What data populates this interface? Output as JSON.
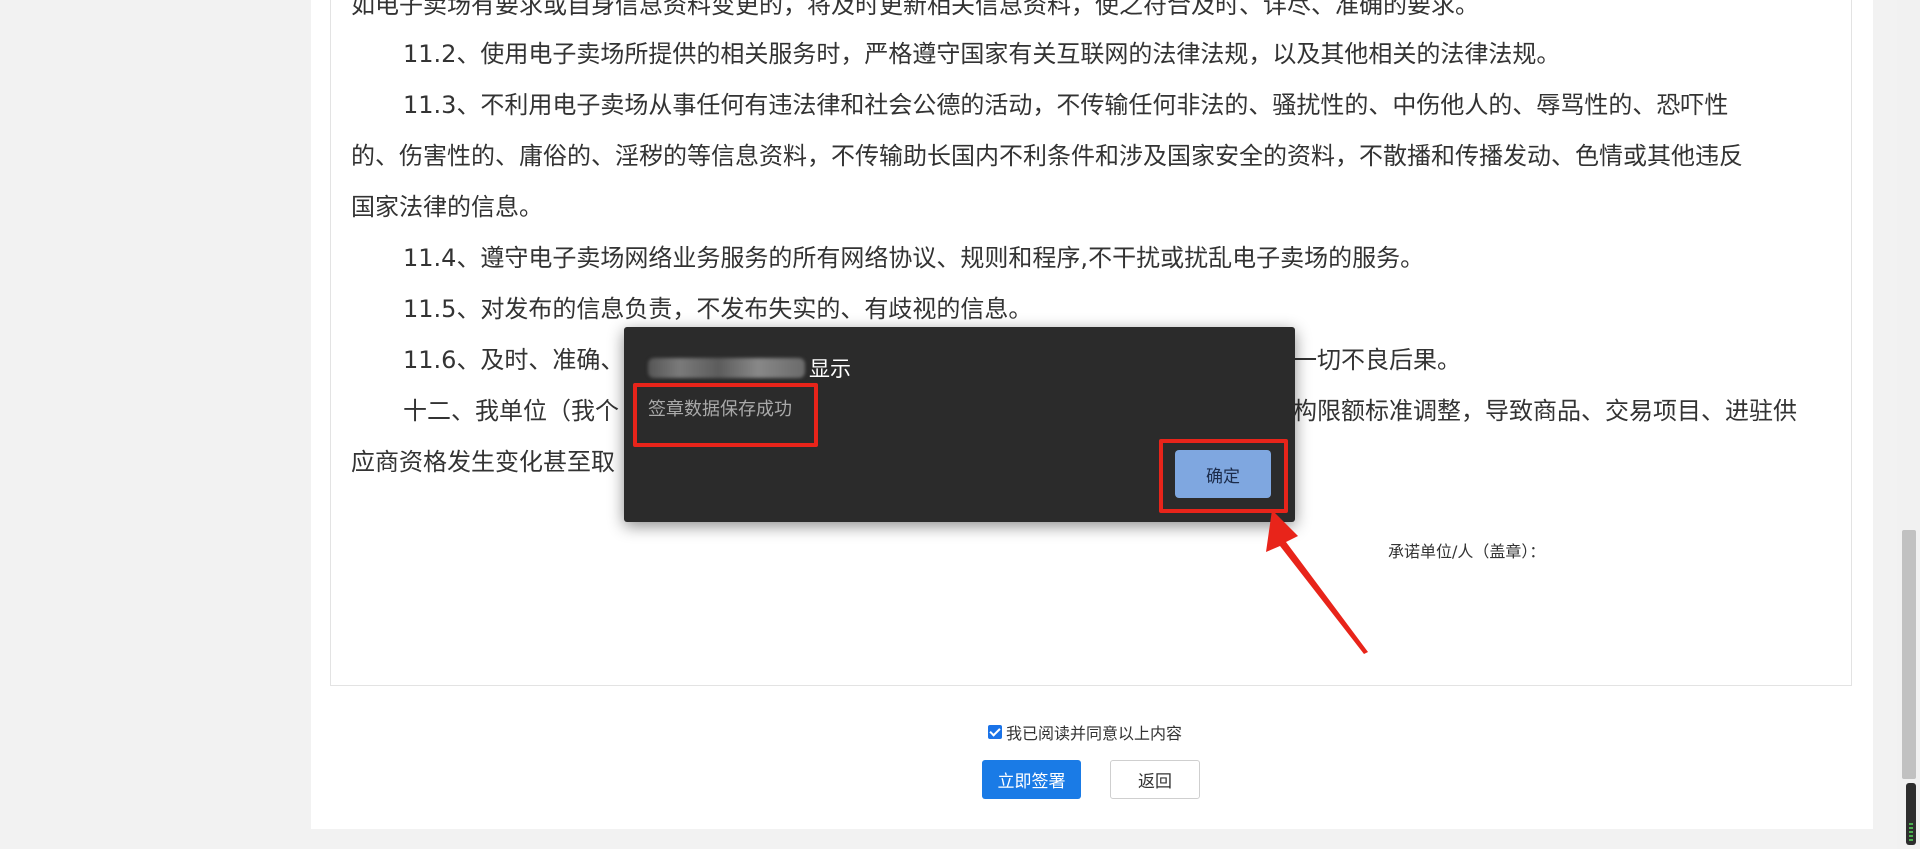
{
  "document": {
    "lines": [
      "如电子卖场有要求或自身信息资料变更的，将及时更新相关信息资料，使之符合及时、详尽、准确的要求。",
      "11.2、使用电子卖场所提供的相关服务时，严格遵守国家有关互联网的法律法规，以及其他相关的法律法规。",
      "11.3、不利用电子卖场从事任何有违法律和社会公德的活动，不传输任何非法的、骚扰性的、中伤他人的、辱骂性的、恐吓性",
      "的、伤害性的、庸俗的、淫秽的等信息资料，不传输助长国内不利条件和涉及国家安全的资料，不散播和传播发动、色情或其他违反",
      "国家法律的信息。",
      "11.4、遵守电子卖场网络业务服务的所有网络协议、规则和程序,不干扰或扰乱电子卖场的服务。",
      "11.5、对发布的信息负责，不发布失实的、有歧视的信息。",
      "11.6、及时、准确、",
      "一切不良后果。",
      "十二、我单位（我个",
      "构限额标准调整，导致商品、交易项目、进驻供",
      "应商资格发生变化甚至取"
    ],
    "pledge_label": "承诺单位/人（盖章）："
  },
  "agreement": {
    "checkbox_label": "我已阅读并同意以上内容",
    "checked": true
  },
  "actions": {
    "sign_label": "立即签署",
    "back_label": "返回"
  },
  "dialog": {
    "title_suffix": "显示",
    "message": "签章数据保存成功",
    "ok_label": "确定"
  },
  "colors": {
    "primary": "#1a7be6",
    "dialog_bg": "#2b2b2b",
    "dialog_button": "#7fa7e0",
    "annotation": "#e8241a"
  }
}
